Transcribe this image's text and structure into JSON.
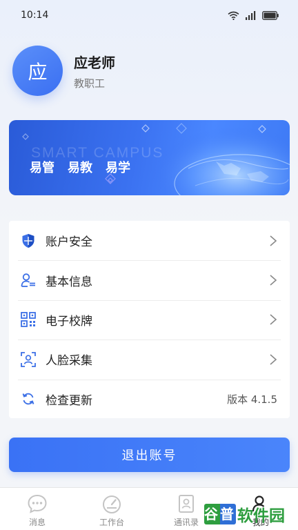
{
  "status_bar": {
    "time": "10:14"
  },
  "profile": {
    "avatar_char": "应",
    "name": "应老师",
    "role": "教职工"
  },
  "banner": {
    "title_en": "SMART CAMPUS",
    "slogans": [
      "易管",
      "易教",
      "易学"
    ]
  },
  "menu": [
    {
      "label": "账户安全",
      "icon": "shield-icon",
      "trailing": "chevron"
    },
    {
      "label": "基本信息",
      "icon": "user-info-icon",
      "trailing": "chevron"
    },
    {
      "label": "电子校牌",
      "icon": "qr-code-icon",
      "trailing": "chevron"
    },
    {
      "label": "人脸采集",
      "icon": "face-scan-icon",
      "trailing": "chevron"
    },
    {
      "label": "检查更新",
      "icon": "refresh-icon",
      "trailing": "value",
      "value": "版本 4.1.5"
    }
  ],
  "logout_label": "退出账号",
  "tabs": [
    {
      "label": "消息",
      "icon": "message-icon"
    },
    {
      "label": "工作台",
      "icon": "dashboard-icon"
    },
    {
      "label": "通讯录",
      "icon": "contacts-icon"
    },
    {
      "label": "我的",
      "icon": "profile-icon"
    }
  ],
  "watermark": {
    "logo": "谷普",
    "text": "软件园"
  },
  "colors": {
    "accent": "#3a72f5",
    "icon_blue": "#3b6fe6",
    "text_primary": "#222222",
    "text_muted": "#888888"
  }
}
